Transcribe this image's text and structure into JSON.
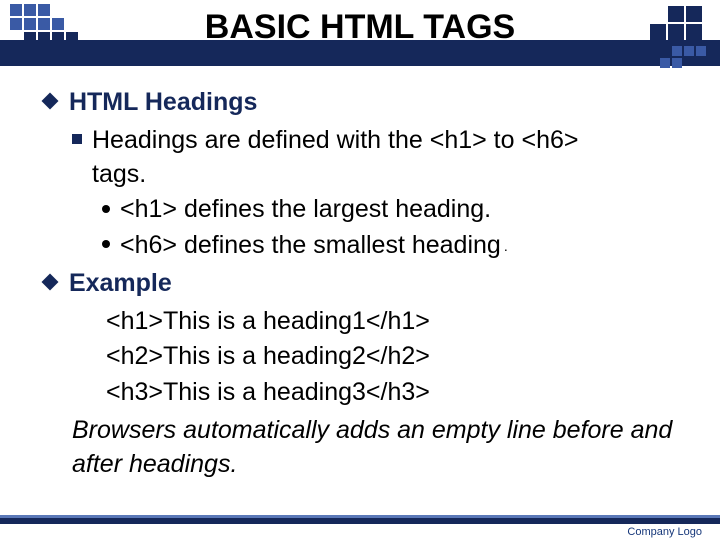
{
  "slide": {
    "title": "BASIC HTML TAGS",
    "sections": [
      {
        "heading": "HTML Headings",
        "bullets": [
          {
            "text_a": "Headings are defined with the <h1> to <h6>",
            "text_b": "tags.",
            "sub": [
              "<h1> defines the largest heading.",
              "<h6> defines the smallest heading"
            ]
          }
        ]
      },
      {
        "heading": "Example",
        "code": [
          "<h1>This is a heading1</h1>",
          "<h2>This is a heading2</h2>",
          "<h3>This is a heading3</h3>"
        ],
        "note": "Browsers automatically adds an empty line before and after headings."
      }
    ]
  },
  "footer": {
    "logo_text": "Company Logo"
  }
}
